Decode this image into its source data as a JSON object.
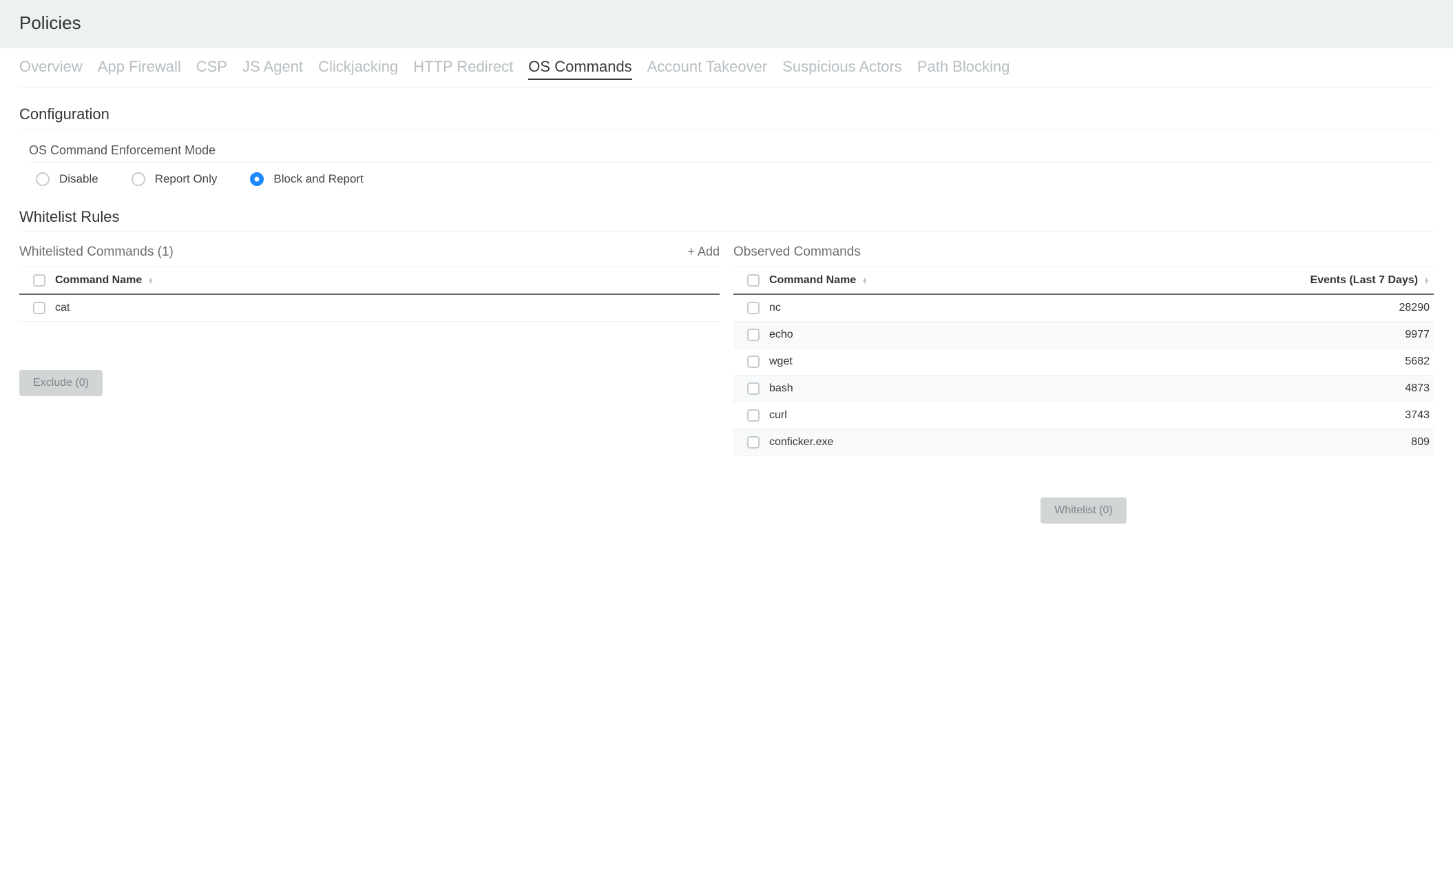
{
  "header": {
    "title": "Policies"
  },
  "tabs": [
    {
      "label": "Overview",
      "active": false
    },
    {
      "label": "App Firewall",
      "active": false
    },
    {
      "label": "CSP",
      "active": false
    },
    {
      "label": "JS Agent",
      "active": false
    },
    {
      "label": "Clickjacking",
      "active": false
    },
    {
      "label": "HTTP Redirect",
      "active": false
    },
    {
      "label": "OS Commands",
      "active": true
    },
    {
      "label": "Account Takeover",
      "active": false
    },
    {
      "label": "Suspicious Actors",
      "active": false
    },
    {
      "label": "Path Blocking",
      "active": false
    }
  ],
  "configuration": {
    "title": "Configuration",
    "mode_label": "OS Command Enforcement Mode",
    "options": [
      {
        "label": "Disable",
        "selected": false
      },
      {
        "label": "Report Only",
        "selected": false
      },
      {
        "label": "Block and Report",
        "selected": true
      }
    ]
  },
  "whitelist": {
    "title": "Whitelist Rules",
    "panel_title": "Whitelisted Commands (1)",
    "add_label": "+ Add",
    "col_name": "Command Name",
    "rows": [
      {
        "name": "cat"
      }
    ],
    "exclude_btn": "Exclude (0)"
  },
  "observed": {
    "panel_title": "Observed Commands",
    "col_name": "Command Name",
    "col_events": "Events (Last 7 Days)",
    "rows": [
      {
        "name": "nc",
        "events": "28290"
      },
      {
        "name": "echo",
        "events": "9977"
      },
      {
        "name": "wget",
        "events": "5682"
      },
      {
        "name": "bash",
        "events": "4873"
      },
      {
        "name": "curl",
        "events": "3743"
      },
      {
        "name": "conficker.exe",
        "events": "809"
      }
    ],
    "whitelist_btn": "Whitelist (0)"
  }
}
